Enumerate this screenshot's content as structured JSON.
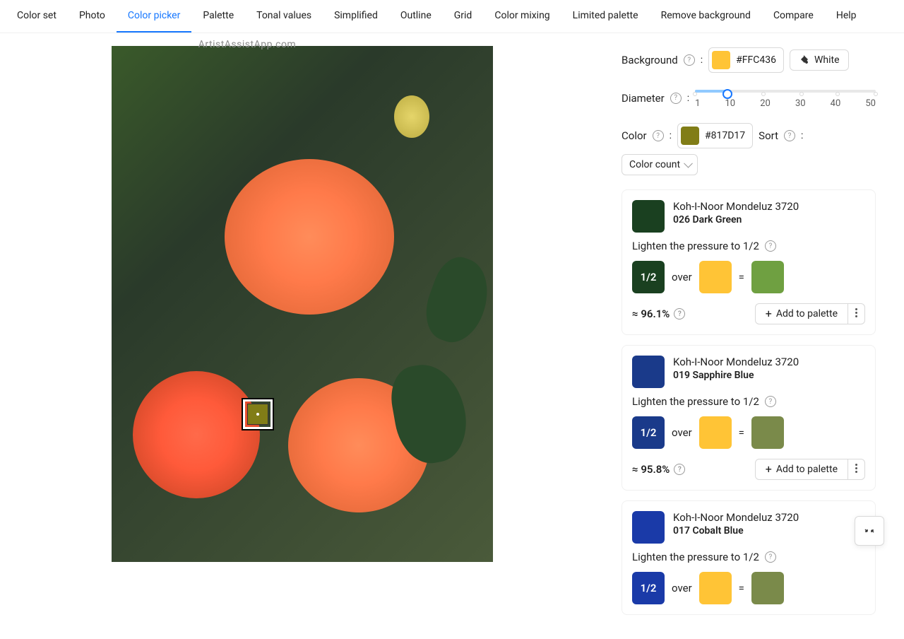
{
  "watermark": "ArtistAssistApp.com",
  "tabs": [
    "Color set",
    "Photo",
    "Color picker",
    "Palette",
    "Tonal values",
    "Simplified",
    "Outline",
    "Grid",
    "Color mixing",
    "Limited palette",
    "Remove background",
    "Compare",
    "Help"
  ],
  "active_tab": "Color picker",
  "controls": {
    "background_label": "Background",
    "background_hex": "#FFC436",
    "background_color": "#FFC436",
    "white_btn": "White",
    "diameter_label": "Diameter",
    "diameter_marks": [
      "1",
      "10",
      "20",
      "30",
      "40",
      "50"
    ],
    "color_label": "Color",
    "color_hex": "#817D17",
    "color_swatch": "#817D17",
    "sort_label": "Sort",
    "sort_value": "Color count",
    "add_label": "Add to palette"
  },
  "results": [
    {
      "swatch": "#1a4020",
      "brand": "Koh-I-Noor Mondeluz 3720",
      "name": "026 Dark Green",
      "instruction": "Lighten the pressure to 1/2",
      "mix": {
        "fraction": "1/2",
        "fraction_bg": "#1a4020",
        "over": "over",
        "over_color": "#FFC436",
        "eq": "=",
        "result_color": "#6fa041"
      },
      "accuracy": "≈ 96.1%"
    },
    {
      "swatch": "#1a3a8a",
      "brand": "Koh-I-Noor Mondeluz 3720",
      "name": "019 Sapphire Blue",
      "instruction": "Lighten the pressure to 1/2",
      "mix": {
        "fraction": "1/2",
        "fraction_bg": "#1a3a8a",
        "over": "over",
        "over_color": "#FFC436",
        "eq": "=",
        "result_color": "#7a8a4a"
      },
      "accuracy": "≈ 95.8%"
    },
    {
      "swatch": "#1a3aa8",
      "brand": "Koh-I-Noor Mondeluz 3720",
      "name": "017 Cobalt Blue",
      "instruction": "Lighten the pressure to 1/2",
      "mix": {
        "fraction": "1/2",
        "fraction_bg": "#1a3aa8",
        "over": "over",
        "over_color": "#FFC436",
        "eq": "=",
        "result_color": "#7a8a4a"
      },
      "accuracy": ""
    }
  ]
}
